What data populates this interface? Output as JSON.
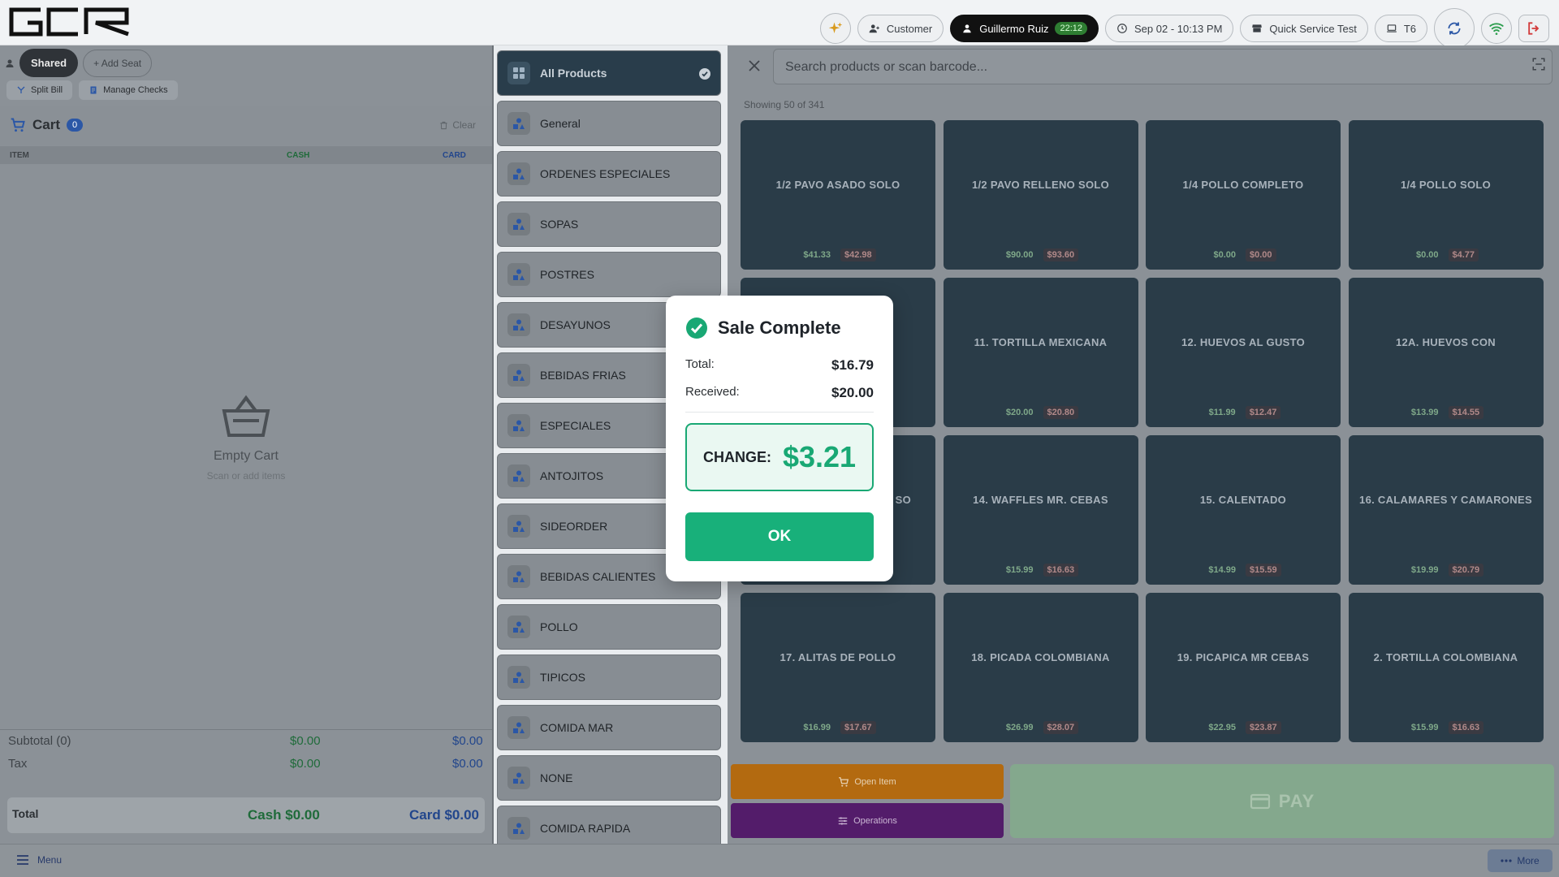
{
  "header": {
    "logo": "GCR",
    "customer_label": "Customer",
    "user_name": "Guillermo Ruiz",
    "user_timer": "22:12",
    "datetime": "Sep 02 - 10:13 PM",
    "store": "Quick Service Test",
    "terminal": "T6"
  },
  "seats": {
    "shared": "Shared",
    "add_seat": "+ Add Seat"
  },
  "cart_actions": {
    "split_bill": "Split Bill",
    "manage_checks": "Manage Checks"
  },
  "cart": {
    "title": "Cart",
    "count": "0",
    "clear": "Clear",
    "col_item": "ITEM",
    "col_cash": "CASH",
    "col_card": "CARD",
    "empty_title": "Empty Cart",
    "empty_sub": "Scan or add items"
  },
  "totals": {
    "subtotal_label": "Subtotal (0)",
    "subtotal_cash": "$0.00",
    "subtotal_card": "$0.00",
    "tax_label": "Tax",
    "tax_cash": "$0.00",
    "tax_card": "$0.00",
    "total_label": "Total",
    "total_cash": "Cash $0.00",
    "total_card": "Card $0.00"
  },
  "categories": [
    "All Products",
    "General",
    "ORDENES ESPECIALES",
    "SOPAS",
    "POSTRES",
    "DESAYUNOS",
    "BEBIDAS FRIAS",
    "ESPECIALES",
    "ANTOJITOS",
    "SIDEORDER",
    "BEBIDAS CALIENTES",
    "POLLO",
    "TIPICOS",
    "COMIDA MAR",
    "NONE",
    "COMIDA RAPIDA"
  ],
  "search": {
    "placeholder": "Search products or scan barcode..."
  },
  "showing": "Showing 50 of 341",
  "products": [
    {
      "name": "1/2 PAVO ASADO SOLO",
      "cash": "$41.33",
      "card": "$42.98"
    },
    {
      "name": "1/2 PAVO RELLENO SOLO",
      "cash": "$90.00",
      "card": "$93.60"
    },
    {
      "name": "1/4 POLLO COMPLETO",
      "cash": "$0.00",
      "card": "$0.00"
    },
    {
      "name": "1/4 POLLO SOLO",
      "cash": "$0.00",
      "card": "$4.77"
    },
    {
      "name": "",
      "cash": "",
      "card": ""
    },
    {
      "name": "11. TORTILLA MEXICANA",
      "cash": "$20.00",
      "card": "$20.80"
    },
    {
      "name": "12. HUEVOS AL GUSTO",
      "cash": "$11.99",
      "card": "$12.47"
    },
    {
      "name": "12A. HUEVOS CON",
      "cash": "$13.99",
      "card": "$14.55"
    },
    {
      "name": "SO",
      "cash": "",
      "card": ""
    },
    {
      "name": "14. WAFFLES  MR. CEBAS",
      "cash": "$15.99",
      "card": "$16.63"
    },
    {
      "name": "15. CALENTADO",
      "cash": "$14.99",
      "card": "$15.59"
    },
    {
      "name": "16. CALAMARES Y CAMARONES",
      "cash": "$19.99",
      "card": "$20.79"
    },
    {
      "name": "17. ALITAS  DE POLLO",
      "cash": "$16.99",
      "card": "$17.67"
    },
    {
      "name": "18. PICADA COLOMBIANA",
      "cash": "$26.99",
      "card": "$28.07"
    },
    {
      "name": "19. PICAPICA MR CEBAS",
      "cash": "$22.95",
      "card": "$23.87"
    },
    {
      "name": "2. TORTILLA COLOMBIANA",
      "cash": "$15.99",
      "card": "$16.63"
    }
  ],
  "bottom_actions": {
    "open_item": "Open Item",
    "operations": "Operations",
    "pay": "PAY"
  },
  "footer": {
    "menu": "Menu",
    "more": "More"
  },
  "modal": {
    "title": "Sale Complete",
    "total_label": "Total:",
    "total_value": "$16.79",
    "received_label": "Received:",
    "received_value": "$20.00",
    "change_label": "CHANGE:",
    "change_value": "$3.21",
    "ok_label": "OK"
  },
  "colors": {
    "accent_green": "#19a874",
    "open_item": "#b36a10",
    "operations": "#531c6a",
    "product_tile": "#2a3c48"
  }
}
